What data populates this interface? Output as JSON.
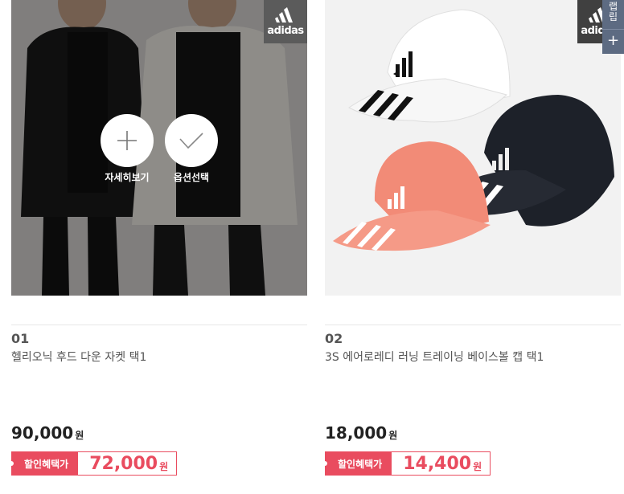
{
  "colors": {
    "sale_accent": "#e94c5f",
    "side_tab": "#5d6b82",
    "overlay": "rgba(0,0,0,0.42)"
  },
  "products": [
    {
      "number": "01",
      "name": "헬리오닉 후드 다운 자켓 택1",
      "price": "90,000",
      "price_unit": "원",
      "sale_label": "할인혜택가",
      "sale_price": "72,000",
      "sale_unit": "원",
      "brand_badge": "adidas",
      "hover_actions": {
        "detail_label": "자세히보기",
        "detail_icon": "plus-icon",
        "option_label": "옵션선택",
        "option_icon": "check-icon"
      }
    },
    {
      "number": "02",
      "name": "3S 에어로레디 러닝 트레이닝 베이스볼 캡 택1",
      "price": "18,000",
      "price_unit": "원",
      "sale_label": "할인혜택가",
      "sale_price": "14,400",
      "sale_unit": "원",
      "brand_badge": "adidas"
    }
  ],
  "side_tab": {
    "label": "랩\n립",
    "plus": "+"
  }
}
